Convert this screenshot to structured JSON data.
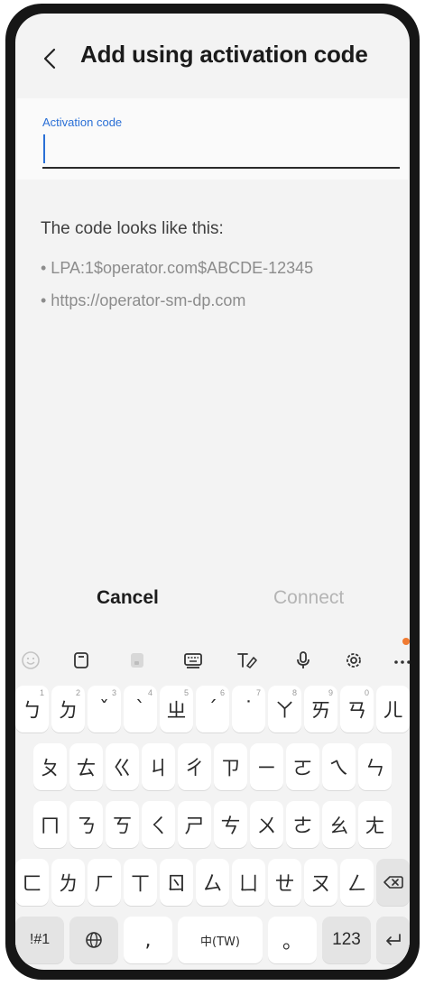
{
  "header": {
    "title": "Add using activation code"
  },
  "input": {
    "label": "Activation code",
    "value": "",
    "placeholder": ""
  },
  "hint": {
    "title": "The code looks like this:",
    "items": [
      "• LPA:1$operator.com$ABCDE-12345",
      "• https://operator-sm-dp.com"
    ]
  },
  "actions": {
    "cancel": "Cancel",
    "connect": "Connect"
  },
  "keyboard_toolbar": {
    "icons": [
      "emoji-icon",
      "clipboard-icon",
      "sticker-icon",
      "keyboard-icon",
      "handwriting-icon",
      "microphone-icon",
      "settings-icon",
      "more-icon"
    ]
  },
  "keyboard": {
    "row1": [
      {
        "k": "ㄅ",
        "h": "1"
      },
      {
        "k": "ㄉ",
        "h": "2"
      },
      {
        "k": "ˇ",
        "h": "3"
      },
      {
        "k": "ˋ",
        "h": "4"
      },
      {
        "k": "ㄓ",
        "h": "5"
      },
      {
        "k": "ˊ",
        "h": "6"
      },
      {
        "k": "˙",
        "h": "7"
      },
      {
        "k": "ㄚ",
        "h": "8"
      },
      {
        "k": "ㄞ",
        "h": "9"
      },
      {
        "k": "ㄢ",
        "h": "0"
      },
      {
        "k": "ㄦ",
        "h": ""
      }
    ],
    "row2": [
      "ㄆ",
      "ㄊ",
      "ㄍ",
      "ㄐ",
      "ㄔ",
      "ㄗ",
      "ㄧ",
      "ㄛ",
      "ㄟ",
      "ㄣ"
    ],
    "row3": [
      "ㄇ",
      "ㄋ",
      "ㄎ",
      "ㄑ",
      "ㄕ",
      "ㄘ",
      "ㄨ",
      "ㄜ",
      "ㄠ",
      "ㄤ"
    ],
    "row4": [
      "ㄈ",
      "ㄌ",
      "ㄏ",
      "ㄒ",
      "ㄖ",
      "ㄙ",
      "ㄩ",
      "ㄝ",
      "ㄡ",
      "ㄥ"
    ],
    "symbols": "!#1",
    "comma": ",",
    "space": "中(TW)",
    "period": "。",
    "numbers": "123"
  }
}
